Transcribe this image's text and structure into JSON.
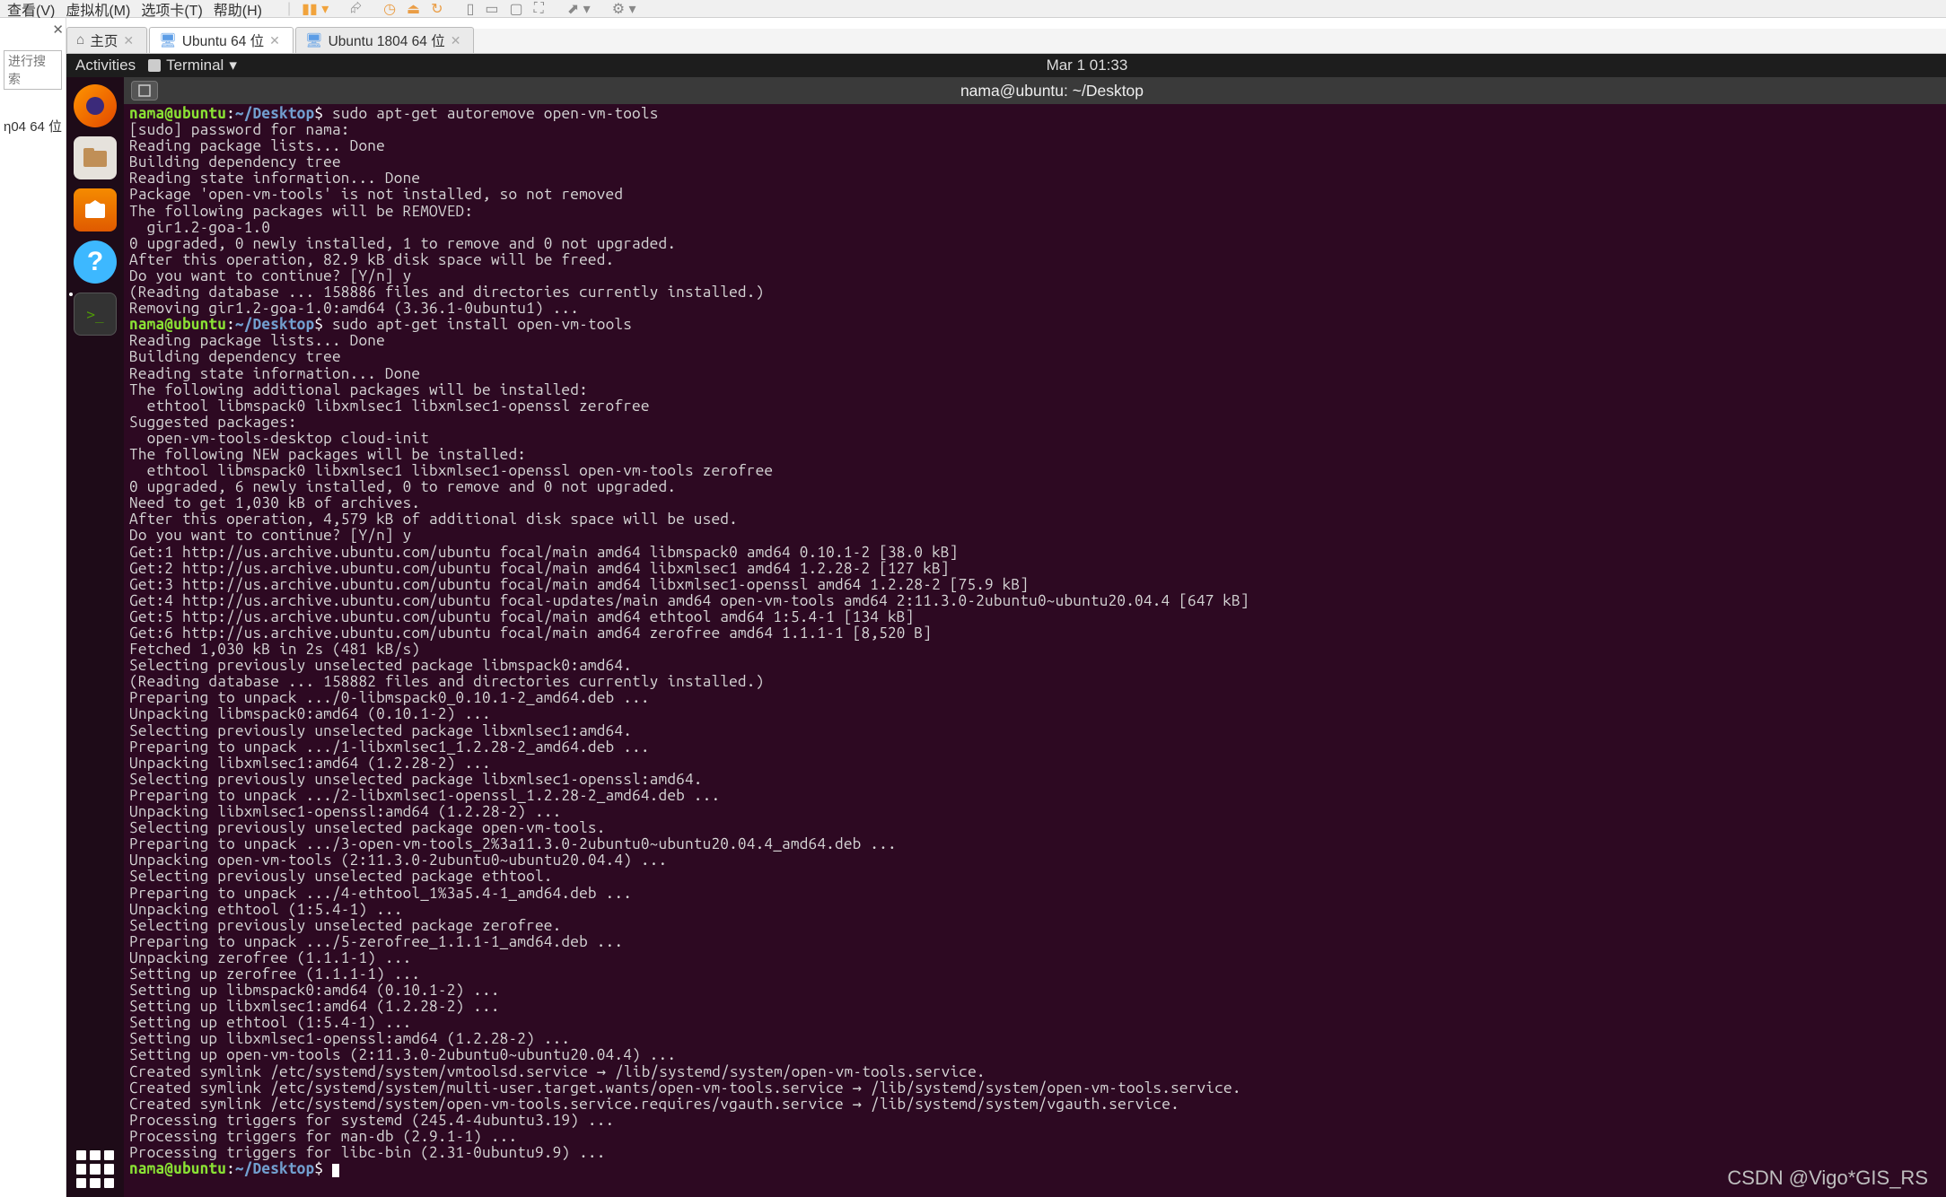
{
  "host_menu": {
    "view": "查看(V)",
    "vm": "虚拟机(M)",
    "tabs_menu": "选项卡(T)",
    "help": "帮助(H)"
  },
  "left_pane": {
    "search_placeholder": "进行搜索",
    "item_name": "η04 64 位"
  },
  "tabs": {
    "home": "主页",
    "ubuntu64": "Ubuntu 64 位",
    "ubuntu1804": "Ubuntu 1804 64 位"
  },
  "gnome": {
    "activities": "Activities",
    "terminal_label": "Terminal",
    "clock": "Mar 1  01:33"
  },
  "term_title": "nama@ubuntu: ~/Desktop",
  "prompt": {
    "user": "nama@ubuntu",
    "colon": ":",
    "path": "~/Desktop",
    "dollar": "$"
  },
  "cmd1": " sudo apt-get autoremove open-vm-tools",
  "cmd2": " sudo apt-get install open-vm-tools",
  "out1": [
    "[sudo] password for nama: ",
    "Reading package lists... Done",
    "Building dependency tree       ",
    "Reading state information... Done",
    "Package 'open-vm-tools' is not installed, so not removed",
    "The following packages will be REMOVED:",
    "  gir1.2-goa-1.0",
    "0 upgraded, 0 newly installed, 1 to remove and 0 not upgraded.",
    "After this operation, 82.9 kB disk space will be freed.",
    "Do you want to continue? [Y/n] y",
    "(Reading database ... 158886 files and directories currently installed.)",
    "Removing gir1.2-goa-1.0:amd64 (3.36.1-0ubuntu1) ..."
  ],
  "out2": [
    "Reading package lists... Done",
    "Building dependency tree       ",
    "Reading state information... Done",
    "The following additional packages will be installed:",
    "  ethtool libmspack0 libxmlsec1 libxmlsec1-openssl zerofree",
    "Suggested packages:",
    "  open-vm-tools-desktop cloud-init",
    "The following NEW packages will be installed:",
    "  ethtool libmspack0 libxmlsec1 libxmlsec1-openssl open-vm-tools zerofree",
    "0 upgraded, 6 newly installed, 0 to remove and 0 not upgraded.",
    "Need to get 1,030 kB of archives.",
    "After this operation, 4,579 kB of additional disk space will be used.",
    "Do you want to continue? [Y/n] y",
    "Get:1 http://us.archive.ubuntu.com/ubuntu focal/main amd64 libmspack0 amd64 0.10.1-2 [38.0 kB]",
    "Get:2 http://us.archive.ubuntu.com/ubuntu focal/main amd64 libxmlsec1 amd64 1.2.28-2 [127 kB]",
    "Get:3 http://us.archive.ubuntu.com/ubuntu focal/main amd64 libxmlsec1-openssl amd64 1.2.28-2 [75.9 kB]",
    "Get:4 http://us.archive.ubuntu.com/ubuntu focal-updates/main amd64 open-vm-tools amd64 2:11.3.0-2ubuntu0~ubuntu20.04.4 [647 kB]",
    "Get:5 http://us.archive.ubuntu.com/ubuntu focal/main amd64 ethtool amd64 1:5.4-1 [134 kB]",
    "Get:6 http://us.archive.ubuntu.com/ubuntu focal/main amd64 zerofree amd64 1.1.1-1 [8,520 B]",
    "Fetched 1,030 kB in 2s (481 kB/s)       ",
    "Selecting previously unselected package libmspack0:amd64.",
    "(Reading database ... 158882 files and directories currently installed.)",
    "Preparing to unpack .../0-libmspack0_0.10.1-2_amd64.deb ...",
    "Unpacking libmspack0:amd64 (0.10.1-2) ...",
    "Selecting previously unselected package libxmlsec1:amd64.",
    "Preparing to unpack .../1-libxmlsec1_1.2.28-2_amd64.deb ...",
    "Unpacking libxmlsec1:amd64 (1.2.28-2) ...",
    "Selecting previously unselected package libxmlsec1-openssl:amd64.",
    "Preparing to unpack .../2-libxmlsec1-openssl_1.2.28-2_amd64.deb ...",
    "Unpacking libxmlsec1-openssl:amd64 (1.2.28-2) ...",
    "Selecting previously unselected package open-vm-tools.",
    "Preparing to unpack .../3-open-vm-tools_2%3a11.3.0-2ubuntu0~ubuntu20.04.4_amd64.deb ...",
    "Unpacking open-vm-tools (2:11.3.0-2ubuntu0~ubuntu20.04.4) ...",
    "Selecting previously unselected package ethtool.",
    "Preparing to unpack .../4-ethtool_1%3a5.4-1_amd64.deb ...",
    "Unpacking ethtool (1:5.4-1) ...",
    "Selecting previously unselected package zerofree.",
    "Preparing to unpack .../5-zerofree_1.1.1-1_amd64.deb ...",
    "Unpacking zerofree (1.1.1-1) ...",
    "Setting up zerofree (1.1.1-1) ...",
    "Setting up libmspack0:amd64 (0.10.1-2) ...",
    "Setting up libxmlsec1:amd64 (1.2.28-2) ...",
    "Setting up ethtool (1:5.4-1) ...",
    "Setting up libxmlsec1-openssl:amd64 (1.2.28-2) ...",
    "Setting up open-vm-tools (2:11.3.0-2ubuntu0~ubuntu20.04.4) ...",
    "Created symlink /etc/systemd/system/vmtoolsd.service → /lib/systemd/system/open-vm-tools.service.",
    "Created symlink /etc/systemd/system/multi-user.target.wants/open-vm-tools.service → /lib/systemd/system/open-vm-tools.service.",
    "Created symlink /etc/systemd/system/open-vm-tools.service.requires/vgauth.service → /lib/systemd/system/vgauth.service.",
    "Processing triggers for systemd (245.4-4ubuntu3.19) ...",
    "Processing triggers for man-db (2.9.1-1) ...",
    "Processing triggers for libc-bin (2.31-0ubuntu9.9) ..."
  ],
  "watermark": "CSDN @Vigo*GIS_RS"
}
